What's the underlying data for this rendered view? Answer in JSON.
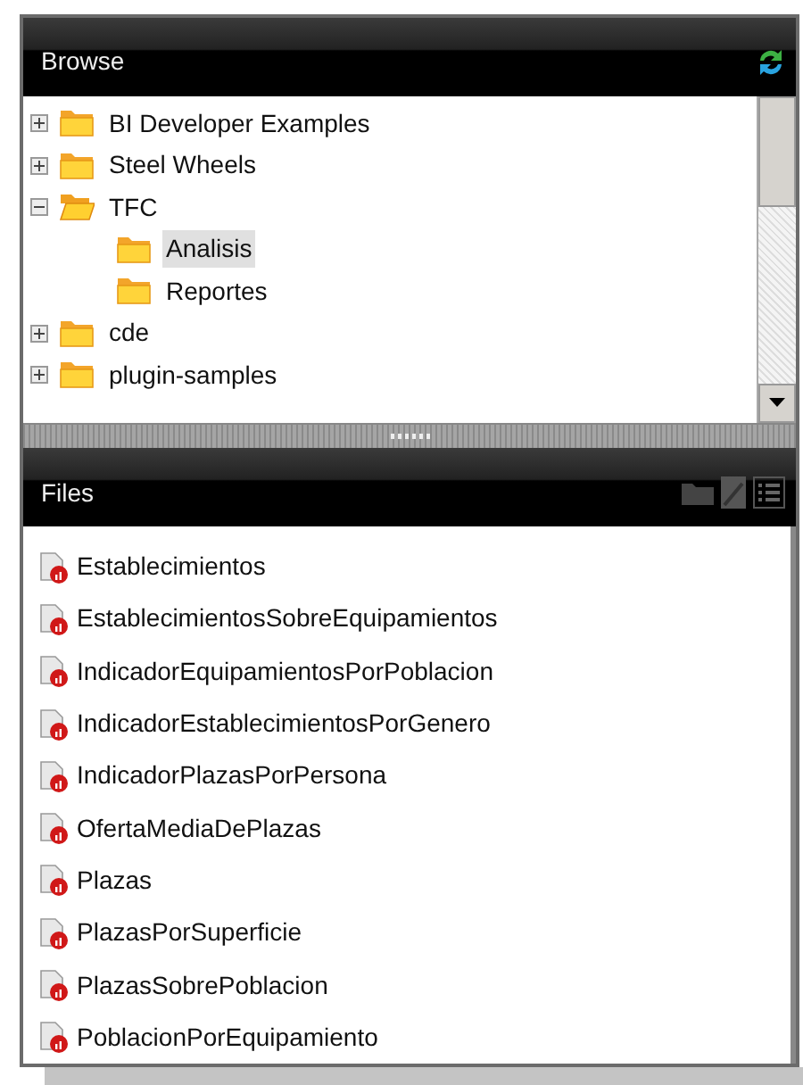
{
  "browse": {
    "title": "Browse",
    "tree": [
      {
        "label": "BI Developer Examples",
        "expanded": false,
        "selected": false
      },
      {
        "label": "Steel Wheels",
        "expanded": false,
        "selected": false
      },
      {
        "label": "TFC",
        "expanded": true,
        "selected": false,
        "children": [
          {
            "label": "Analisis",
            "selected": true
          },
          {
            "label": "Reportes",
            "selected": false
          }
        ]
      },
      {
        "label": "cde",
        "expanded": false,
        "selected": false
      },
      {
        "label": "plugin-samples",
        "expanded": false,
        "selected": false
      }
    ]
  },
  "files": {
    "title": "Files",
    "items": [
      {
        "label": "Establecimientos"
      },
      {
        "label": "EstablecimientosSobreEquipamientos"
      },
      {
        "label": "IndicadorEquipamientosPorPoblacion"
      },
      {
        "label": "IndicadorEstablecimientosPorGenero"
      },
      {
        "label": "IndicadorPlazasPorPersona"
      },
      {
        "label": "OfertaMediaDePlazas"
      },
      {
        "label": "Plazas"
      },
      {
        "label": "PlazasPorSuperficie"
      },
      {
        "label": "PlazasSobrePoblacion"
      },
      {
        "label": "PoblacionPorEquipamiento"
      }
    ]
  }
}
